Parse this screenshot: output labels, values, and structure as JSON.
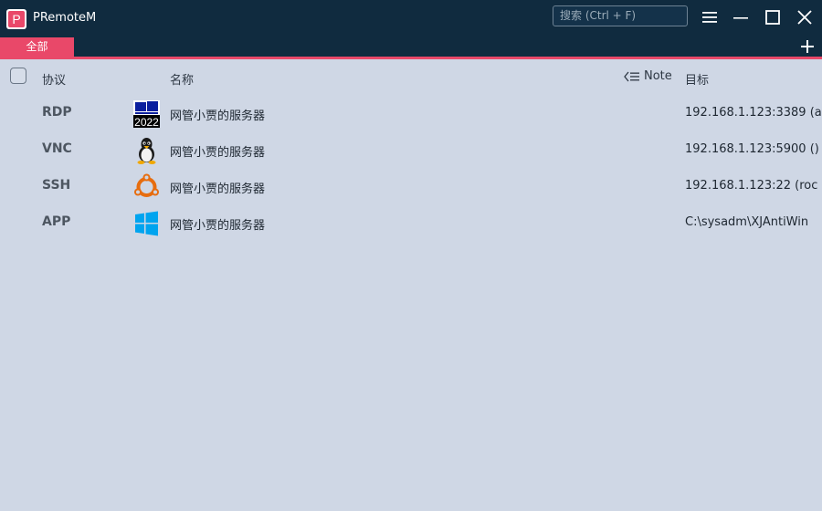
{
  "app": {
    "title": "PRemoteM",
    "logo_letter": "P"
  },
  "search": {
    "placeholder": "搜索 (Ctrl + F)"
  },
  "tabs": [
    {
      "label": "全部"
    }
  ],
  "columns": {
    "protocol": "协议",
    "name": "名称",
    "note": "Note",
    "target": "目标"
  },
  "rows": [
    {
      "protocol": "RDP",
      "icon": "windows-2022-icon",
      "icon_text": "2022",
      "name": "网管小贾的服务器",
      "target": "192.168.1.123:3389 (a"
    },
    {
      "protocol": "VNC",
      "icon": "linux-tux-icon",
      "name": "网管小贾的服务器",
      "target": "192.168.1.123:5900 ()"
    },
    {
      "protocol": "SSH",
      "icon": "ubuntu-icon",
      "name": "网管小贾的服务器",
      "target": "192.168.1.123:22 (roc"
    },
    {
      "protocol": "APP",
      "icon": "windows-icon",
      "name": "网管小贾的服务器",
      "target": "C:\\sysadm\\XJAntiWin"
    }
  ],
  "colors": {
    "titlebar": "#102b3f",
    "accent": "#e94869",
    "background": "#cfd7e5"
  }
}
